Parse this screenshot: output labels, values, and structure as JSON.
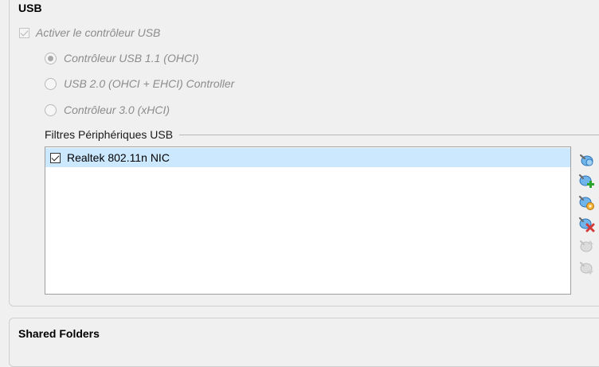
{
  "usb_section": {
    "title": "USB",
    "enable_label": "Activer le contrôleur USB",
    "options": [
      {
        "label": "Contrôleur USB 1.1 (OHCI)",
        "selected": true
      },
      {
        "label": "USB 2.0 (OHCI + EHCI) Controller",
        "selected": false
      },
      {
        "label": "Contrôleur 3.0 (xHCI)",
        "selected": false
      }
    ],
    "filters_title": "Filtres Périphériques USB",
    "filters": [
      {
        "label": "Realtek 802.11n NIC",
        "checked": true,
        "selected": true
      }
    ],
    "toolbar": [
      {
        "name": "add-empty-filter-icon",
        "enabled": true
      },
      {
        "name": "add-filter-from-device-icon",
        "enabled": true
      },
      {
        "name": "edit-filter-icon",
        "enabled": true
      },
      {
        "name": "remove-filter-icon",
        "enabled": true
      },
      {
        "name": "move-filter-up-icon",
        "enabled": false
      },
      {
        "name": "move-filter-down-icon",
        "enabled": false
      }
    ]
  },
  "shared_folders_section": {
    "title": "Shared Folders"
  },
  "colors": {
    "selection": "#cce8ff",
    "disabled_text": "#8c8c8c",
    "usb_icon_blue": "#3a8fd8",
    "add_green": "#2ea52e",
    "edit_orange": "#e59a1c",
    "remove_red": "#d43a3a"
  }
}
